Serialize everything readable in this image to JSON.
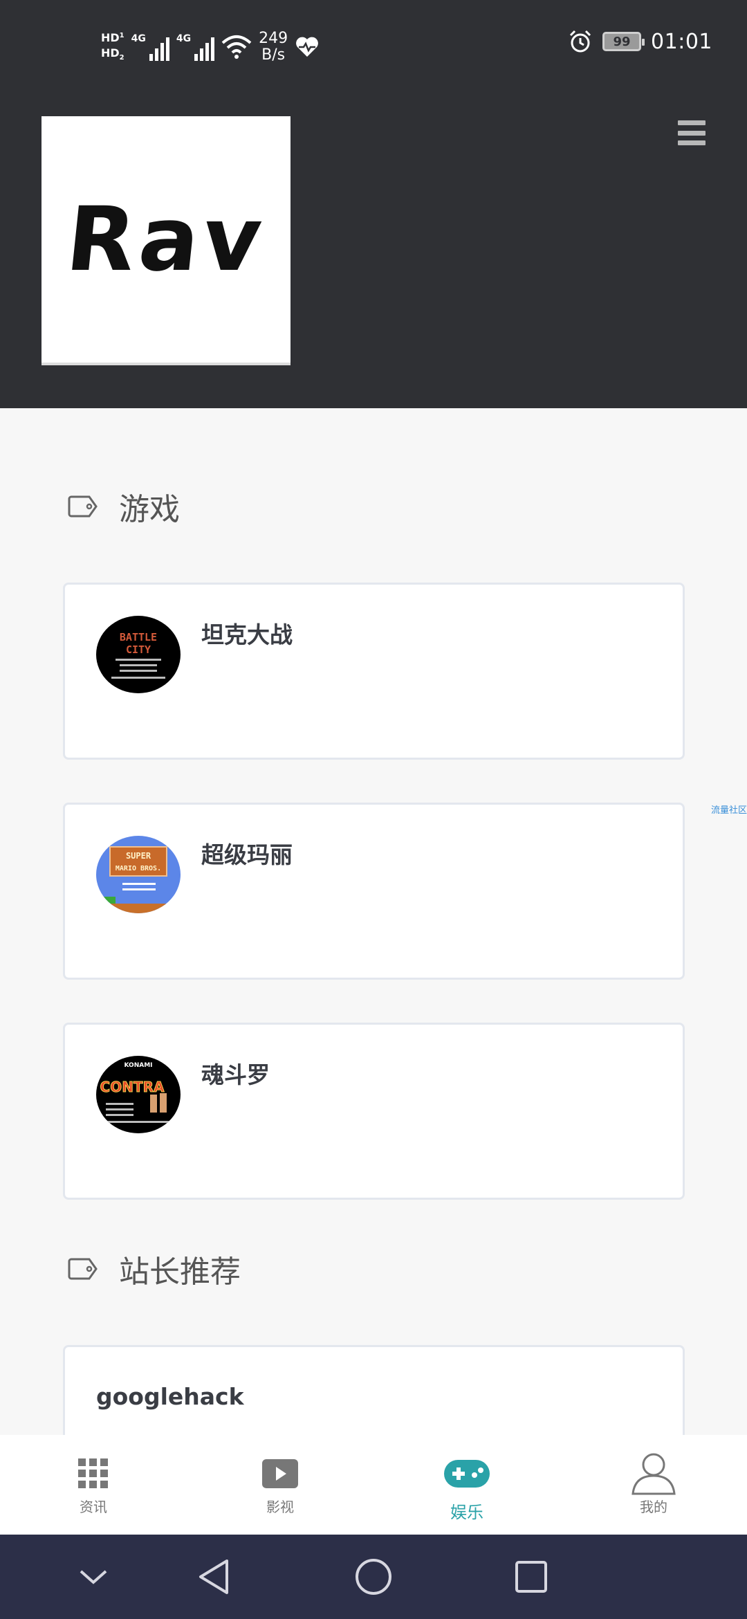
{
  "status_bar": {
    "sim1": "HD",
    "sim1_index": "1",
    "sim2": "HD",
    "sim2_index": "2",
    "network1": "4G",
    "network2": "4G",
    "speed_value": "249",
    "speed_unit": "B/s",
    "battery": "99",
    "time": "01:01"
  },
  "header": {
    "logo_text": "Rav"
  },
  "sections": [
    {
      "title": "游戏",
      "items": [
        {
          "name": "坦克大战",
          "thumb_caption": "BATTLE CITY"
        },
        {
          "name": "超级玛丽",
          "thumb_caption": "SUPER MARIO BROS."
        },
        {
          "name": "魂斗罗",
          "thumb_caption": "CONTRA"
        }
      ]
    },
    {
      "title": "站长推荐",
      "items": [
        {
          "name": "googlehack"
        }
      ]
    }
  ],
  "side_link": "流量社区",
  "bottom_nav": [
    {
      "label": "资讯",
      "icon": "grid-icon",
      "active": false
    },
    {
      "label": "影视",
      "icon": "play-icon",
      "active": false
    },
    {
      "label": "娱乐",
      "icon": "gamepad-icon",
      "active": true
    },
    {
      "label": "我的",
      "icon": "user-icon",
      "active": false
    }
  ],
  "colors": {
    "header_bg": "#2f3034",
    "accent": "#2aa2a8",
    "system_nav_bg": "#2c2f48"
  }
}
